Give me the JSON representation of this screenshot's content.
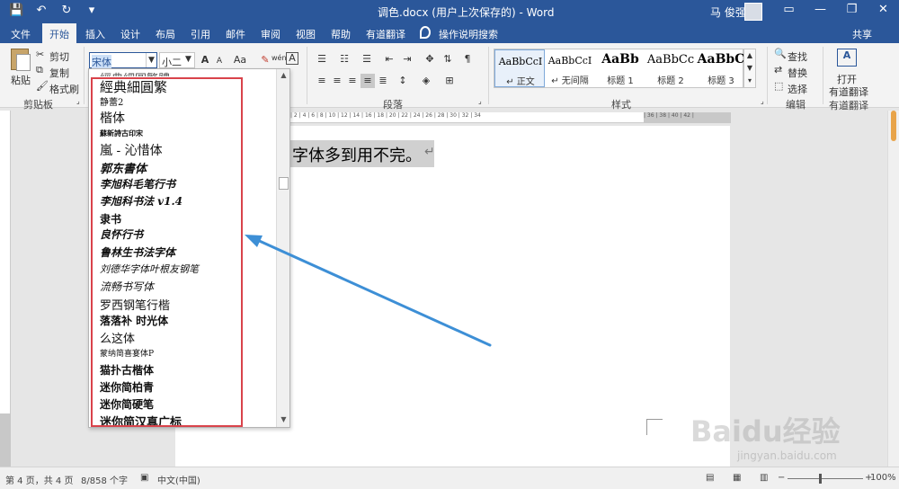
{
  "titlebar": {
    "title": "调色.docx (用户上次保存的) - Word",
    "user": "马 俊强",
    "qat": [
      "💾",
      "↶",
      "↻",
      "▾"
    ],
    "winctl": [
      "▭",
      "—",
      "❐",
      "✕"
    ]
  },
  "tabs": [
    "文件",
    "开始",
    "插入",
    "设计",
    "布局",
    "引用",
    "邮件",
    "审阅",
    "视图",
    "帮助",
    "有道翻译",
    "操作说明搜索"
  ],
  "share": "共享",
  "ribbon": {
    "clipboard": {
      "paste": "粘贴",
      "cut": "剪切",
      "copy": "复制",
      "format_painter": "格式刷",
      "label": "剪贴板"
    },
    "font": {
      "name": "宋体",
      "size": "小二",
      "grow": "A",
      "shrink": "A",
      "case": "Aa",
      "wen": "wén",
      "char_border": "A"
    },
    "paragraph_label": "段落",
    "styles_label": "样式",
    "styles": [
      {
        "sample": "AaBbCcI",
        "name": "↵ 正文"
      },
      {
        "sample": "AaBbCcI",
        "name": "↵ 无间隔"
      },
      {
        "sample": "AaBb",
        "name": "标题 1"
      },
      {
        "sample": "AaBbCc",
        "name": "标题 2"
      },
      {
        "sample": "AaBbC",
        "name": "标题 3"
      }
    ],
    "editing": {
      "find": "查找",
      "replace": "替换",
      "select": "选择",
      "label": "编辑"
    },
    "youdao": {
      "open": "打开",
      "translate": "有道翻译",
      "label": "有道翻译"
    }
  },
  "ruler_text": "| 2 | 4 | 6 | 8 | 10 | 12 | 14 | 16 | 18 | 20 | 22 | 24 | 26 | 28 | 30 | 32 | 34",
  "ruler_gray_text": "| 36 | 38 | 40 | 42 |",
  "document": {
    "text": "字体多到用不完。",
    "para_mark": "↵"
  },
  "font_list": [
    "經典細圓繁",
    "静蕾2",
    "楷体",
    "蘇新詩古印宋",
    "嵐 - 沁惜体",
    "郭东書体",
    "李旭科毛笔行书",
    "李旭科书法 v1.4",
    "隶书",
    "良怀行书",
    "鲁林生书法字体",
    "刘德华字体叶根友钢笔",
    "流畅书写体",
    "罗西钢笔行楷",
    "落落补 时光体",
    "么这体",
    "蒙纳简喜宴体P",
    "猫扑古楷体",
    "迷你简柏青",
    "迷你简硬笔",
    "迷你简汉真广标"
  ],
  "statusbar": {
    "page": "第 4 页，共 4 页",
    "words": "8/858 个字",
    "lang": "中文(中国)",
    "zoom": "100%"
  },
  "watermark": {
    "text": "Baidu经验",
    "sub": "jingyan.baidu.com"
  },
  "colors": {
    "word_blue": "#2b579a",
    "annotation_red": "#d9434b",
    "arrow_blue": "#3d8fd6"
  }
}
